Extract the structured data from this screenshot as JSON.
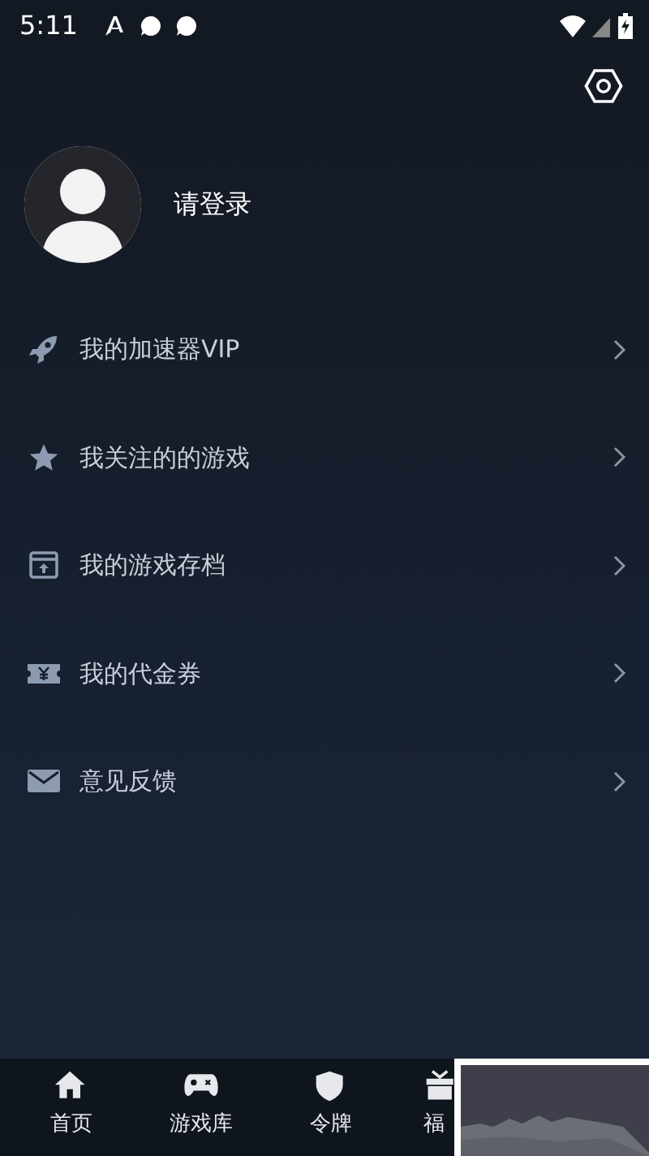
{
  "status_bar": {
    "time": "5:11"
  },
  "profile": {
    "login_text": "请登录"
  },
  "menu": [
    {
      "label": "我的加速器VIP",
      "kind": "rocket"
    },
    {
      "label": "我关注的的游戏",
      "kind": "star"
    },
    {
      "label": "我的游戏存档",
      "kind": "archive"
    },
    {
      "label": "我的代金券",
      "kind": "voucher"
    },
    {
      "label": "意见反馈",
      "kind": "mail"
    }
  ],
  "bottom_nav": [
    {
      "label": "首页",
      "kind": "home",
      "selected": false
    },
    {
      "label": "游戏库",
      "kind": "gamepad",
      "selected": false
    },
    {
      "label": "令牌",
      "kind": "shield",
      "selected": false
    },
    {
      "label": "福",
      "kind": "gift",
      "selected": false
    }
  ]
}
